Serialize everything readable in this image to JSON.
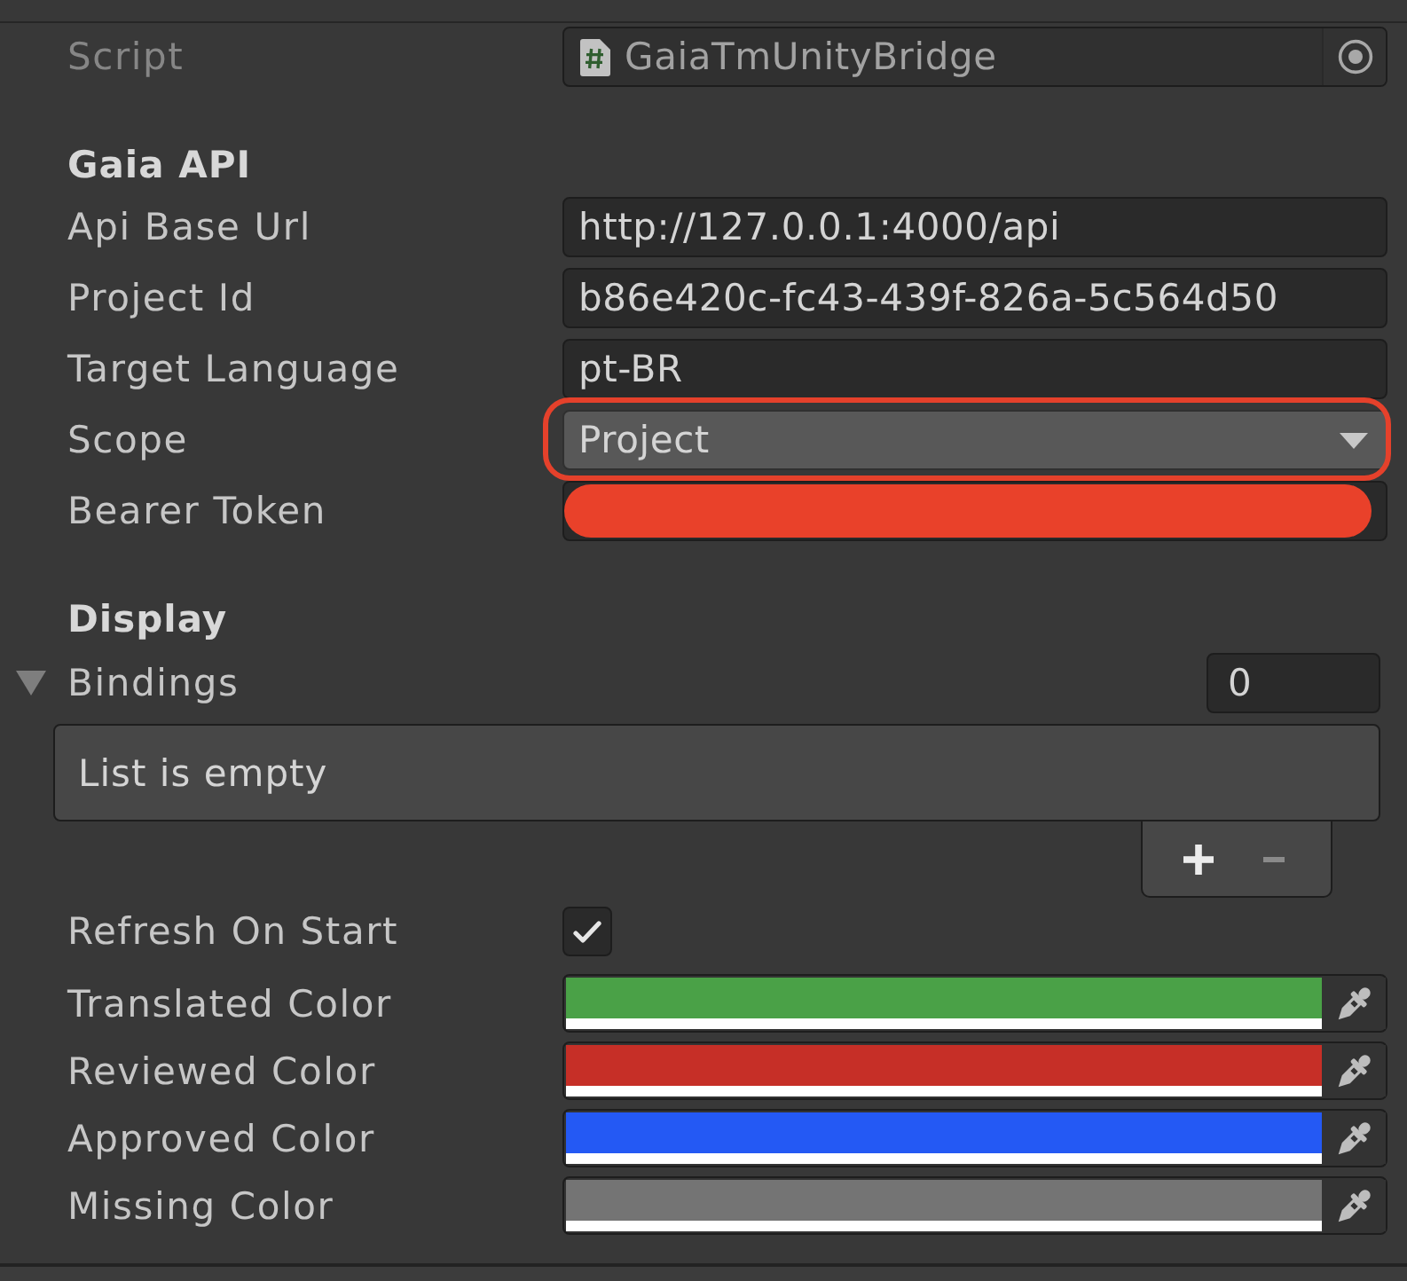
{
  "script": {
    "label": "Script",
    "value": "GaiaTmUnityBridge",
    "disabled": true
  },
  "sections": [
    {
      "title": "Gaia API",
      "fields": [
        {
          "kind": "text",
          "label": "Api Base Url",
          "value": "http://127.0.0.1:4000/api"
        },
        {
          "kind": "text",
          "label": "Project Id",
          "value": "b86e420c-fc43-439f-826a-5c564d50"
        },
        {
          "kind": "text",
          "label": "Target Language",
          "value": "pt-BR"
        },
        {
          "kind": "dropdown",
          "label": "Scope",
          "value": "Project",
          "highlighted": true
        },
        {
          "kind": "text",
          "label": "Bearer Token",
          "redacted": true
        }
      ]
    },
    {
      "title": "Display",
      "fields": [
        {
          "kind": "list",
          "label": "Bindings",
          "expanded": true,
          "size": "0",
          "empty_text": "List is empty",
          "buttons": [
            {
              "kind": "add",
              "disabled": false
            },
            {
              "kind": "remove",
              "disabled": true
            }
          ]
        },
        {
          "kind": "checkbox",
          "label": "Refresh On Start",
          "checked": true
        },
        {
          "kind": "color",
          "label": "Translated Color",
          "color": "#4aa147"
        },
        {
          "kind": "color",
          "label": "Reviewed Color",
          "color": "#c62f27"
        },
        {
          "kind": "color",
          "label": "Approved Color",
          "color": "#2459f4"
        },
        {
          "kind": "color",
          "label": "Missing Color",
          "color": "#747474"
        }
      ]
    }
  ]
}
